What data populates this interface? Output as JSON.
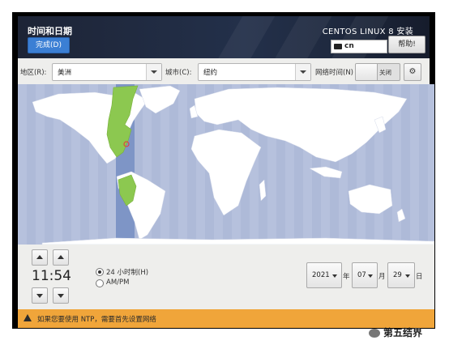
{
  "header": {
    "title": "时间和日期",
    "done_button": "完成(D)",
    "product": "CENTOS LINUX 8 安装",
    "keyboard_layout": "cn",
    "help_button": "帮助!"
  },
  "toolbar": {
    "region_label": "地区(R):",
    "region_value": "美洲",
    "city_label": "城市(C):",
    "city_value": "纽约",
    "network_time_label": "网络时间(N)",
    "network_time_state": "关闭"
  },
  "map": {
    "selected_timezone_color": "#8cc850",
    "ocean_color": "#aebad8",
    "land_color": "#ffffff",
    "pin": "location-pin-icon"
  },
  "time": {
    "value": "11:54",
    "format_24h_label": "24 小时制(H)",
    "format_ampm_label": "AM/PM",
    "selected_format": "24h"
  },
  "date": {
    "year": "2021",
    "year_suffix": "年",
    "month": "07",
    "month_suffix": "月",
    "day": "29",
    "day_suffix": "日"
  },
  "warning": {
    "text": "如果您要使用 NTP，需要首先设置网络",
    "color": "#f0a53a"
  },
  "watermark": {
    "text": "第五结界"
  }
}
